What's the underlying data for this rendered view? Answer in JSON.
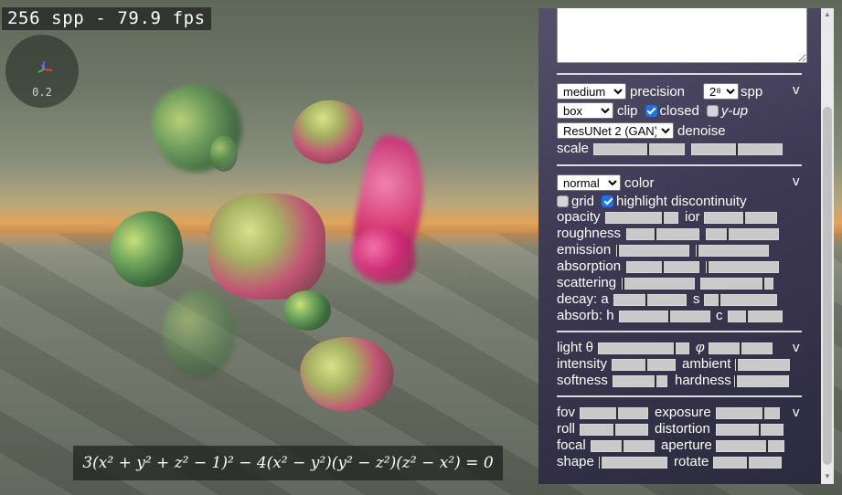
{
  "stats": {
    "text": "256 spp - 79.9 fps"
  },
  "gizmo": {
    "value": "0.2"
  },
  "equation": {
    "text": "3(x² + y² + z² − 1)² − 4(x² − y²)(y² − z²)(z² − x²) = 0"
  },
  "render": {
    "precision_value": "medium",
    "precision_label": "precision",
    "spp_value": "2⁸",
    "spp_label": "spp",
    "clip_value": "box",
    "clip_label": "clip",
    "closed_label": "closed",
    "closed_checked": true,
    "yup_label": "y-up",
    "yup_checked": false,
    "denoise_value": "ResUNet 2 (GAN)",
    "denoise_label": "denoise",
    "scale_label": "scale",
    "scale_a": 0.6,
    "scale_b": 0.5,
    "toggle": "v"
  },
  "material": {
    "color_value": "normal",
    "color_label": "color",
    "grid_label": "grid",
    "grid_checked": false,
    "highlight_label": "highlight discontinuity",
    "highlight_checked": true,
    "opacity_label": "opacity",
    "opacity": 0.8,
    "ior_label": "ior",
    "ior": 0.55,
    "roughness_label": "roughness",
    "roughness_a": 0.4,
    "roughness_b": 0.3,
    "emission_label": "emission",
    "emission_a": 0.0,
    "emission_b": 0.0,
    "absorption_label": "absorption",
    "absorption_a": 0.5,
    "absorption_b": 0.0,
    "scattering_label": "scattering",
    "scattering_a": 0.0,
    "scattering_b": 0.87,
    "decay_label": "decay: a",
    "decay_a": 0.45,
    "decay_s_label": "s",
    "decay_s": 0.2,
    "absorb_label": "absorb: h",
    "absorb_h": 0.55,
    "absorb_c_label": "c",
    "absorb_c": 0.35,
    "toggle": "v"
  },
  "light": {
    "theta_label": "light θ",
    "theta": 0.85,
    "phi_label": "φ",
    "phi": 0.5,
    "intensity_label": "intensity",
    "intensity": 0.55,
    "ambient_label": "ambient",
    "ambient": 0.0,
    "softness_label": "softness",
    "softness": 0.8,
    "hardness_label": "hardness",
    "hardness": 0.0,
    "toggle": "v"
  },
  "camera": {
    "fov_label": "fov",
    "fov": 0.55,
    "exposure_label": "exposure",
    "exposure": 0.75,
    "roll_label": "roll",
    "roll": 0.5,
    "distortion_label": "distortion",
    "distortion": 0.65,
    "focal_label": "focal",
    "focal": 0.5,
    "aperture_label": "aperture",
    "aperture": 0.75,
    "shape_label": "shape",
    "shape": 0.0,
    "rotate_label": "rotate",
    "rotate": 0.5,
    "toggle": "v"
  },
  "colors": {
    "checkbox_on": "#1a73e8",
    "panel_top": "#55506b",
    "panel_bottom": "#2b2a3d"
  }
}
